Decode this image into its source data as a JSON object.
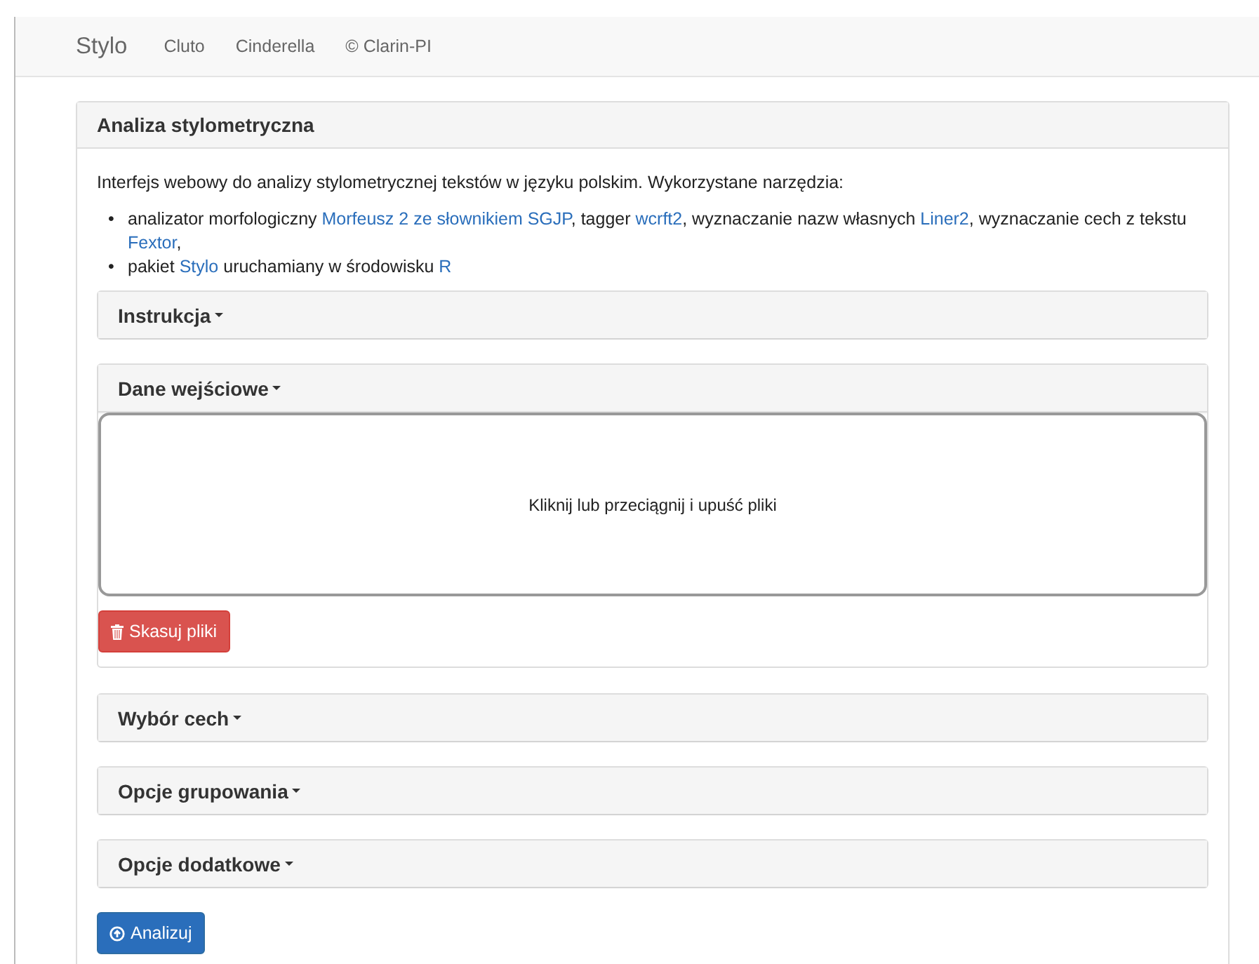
{
  "navbar": {
    "brand": "Stylo",
    "links": [
      "Cluto",
      "Cinderella",
      "© Clarin-PI"
    ]
  },
  "panel": {
    "title": "Analiza stylometryczna",
    "intro": "Interfejs webowy do analizy stylometrycznej tekstów w języku polskim. Wykorzystane narzędzia:",
    "bullets": [
      {
        "marker": "•",
        "segments": [
          {
            "text": "analizator morfologiczny ",
            "kind": "text"
          },
          {
            "text": "Morfeusz 2 ze słownikiem SGJP",
            "kind": "link"
          },
          {
            "text": ", tagger ",
            "kind": "text"
          },
          {
            "text": "wcrft2",
            "kind": "link"
          },
          {
            "text": ", wyznaczanie nazw własnych ",
            "kind": "text"
          },
          {
            "text": "Liner2",
            "kind": "link"
          },
          {
            "text": ", wyznaczanie cech z tekstu ",
            "kind": "text"
          },
          {
            "text": "Fextor",
            "kind": "link"
          },
          {
            "text": ",",
            "kind": "text"
          }
        ]
      },
      {
        "marker": "•",
        "segments": [
          {
            "text": "pakiet ",
            "kind": "text"
          },
          {
            "text": "Stylo",
            "kind": "link"
          },
          {
            "text": " uruchamiany w środowisku ",
            "kind": "text"
          },
          {
            "text": "R",
            "kind": "link"
          }
        ]
      }
    ],
    "sections": [
      {
        "title": "Instrukcja",
        "expanded": false
      },
      {
        "title": "Dane wejściowe",
        "expanded": true,
        "dropzone": "Kliknij lub przeciągnij i upuść pliki",
        "delete_button": "Skasuj pliki"
      },
      {
        "title": "Wybór cech",
        "expanded": false
      },
      {
        "title": "Opcje grupowania",
        "expanded": false
      },
      {
        "title": "Opcje dodatkowe",
        "expanded": false
      }
    ],
    "submit": "Analizuj"
  }
}
